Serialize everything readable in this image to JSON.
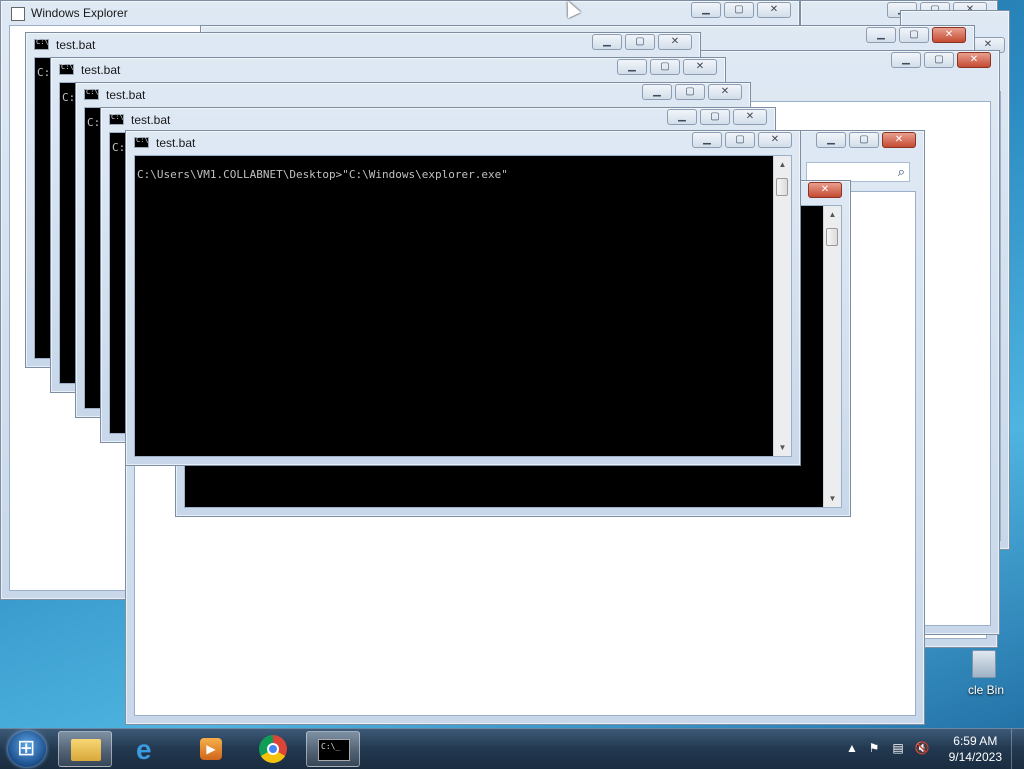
{
  "explorer": {
    "title": "Windows Explorer",
    "controls": {
      "minimize": "▭",
      "maximize": "▢",
      "close": "✕"
    }
  },
  "console_windows": [
    {
      "title": "test.bat",
      "prompt_fragment": "C:"
    },
    {
      "title": "test.bat",
      "prompt_fragment": "C:"
    },
    {
      "title": "test.bat",
      "prompt_fragment": "C:"
    },
    {
      "title": "test.bat",
      "prompt_fragment": "C:"
    },
    {
      "title": "test.bat",
      "command_line": "C:\\Users\\VM1.COLLABNET\\Desktop>\"C:\\Windows\\explorer.exe\""
    }
  ],
  "icons": {
    "console": "console-icon",
    "search": "search-icon",
    "minimize": "minimize-icon",
    "maximize": "maximize-icon",
    "close": "close-icon"
  },
  "desktop": {
    "recycle_bin_label": "cle Bin"
  },
  "taskbar": {
    "pinned": [
      "windows-explorer",
      "internet-explorer",
      "windows-media-player",
      "google-chrome",
      "command-prompt"
    ],
    "clock_time": "6:59 AM",
    "clock_date": "9/14/2023",
    "tray_icons": [
      "show-hidden-icons",
      "action-center-flag-icon",
      "network-icon",
      "volume-muted-icon"
    ]
  },
  "colors": {
    "close_red": "#c44a32",
    "console_bg": "#000000",
    "console_text": "#c0c0c0",
    "taskbar": "#22384f"
  }
}
